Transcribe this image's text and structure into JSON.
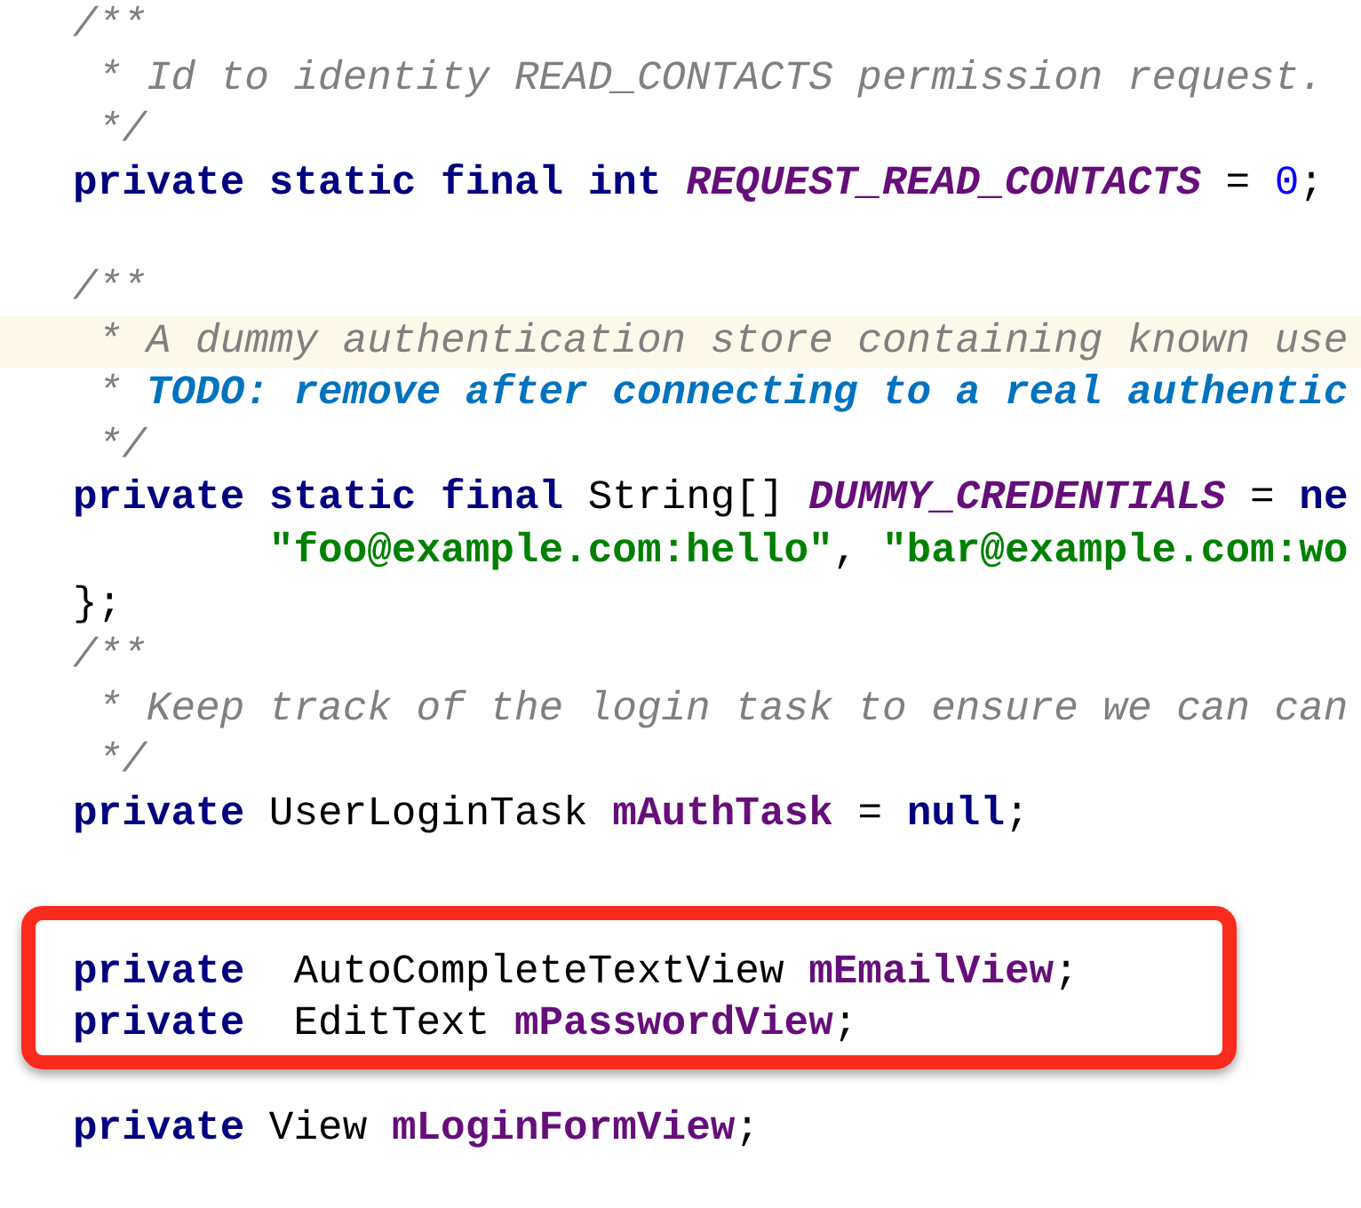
{
  "editor": {
    "lines": [
      {
        "kind": "code",
        "highlighted": false,
        "segments": [
          {
            "kind": "comment",
            "text": "/**"
          }
        ]
      },
      {
        "kind": "code",
        "highlighted": false,
        "segments": [
          {
            "kind": "comment",
            "text": " * Id to identity READ_CONTACTS permission request."
          }
        ]
      },
      {
        "kind": "code",
        "highlighted": false,
        "segments": [
          {
            "kind": "comment",
            "text": " */"
          }
        ]
      },
      {
        "kind": "code",
        "highlighted": false,
        "segments": [
          {
            "kind": "keyword",
            "text": "private static final int "
          },
          {
            "kind": "constant",
            "text": "REQUEST_READ_CONTACTS"
          },
          {
            "kind": "plain",
            "text": " = "
          },
          {
            "kind": "number",
            "text": "0"
          },
          {
            "kind": "plain",
            "text": ";"
          }
        ]
      },
      {
        "kind": "blank"
      },
      {
        "kind": "code",
        "highlighted": false,
        "segments": [
          {
            "kind": "comment",
            "text": "/**"
          }
        ]
      },
      {
        "kind": "code",
        "highlighted": true,
        "segments": [
          {
            "kind": "comment",
            "text": " * A dummy authentication store containing known use"
          }
        ]
      },
      {
        "kind": "code",
        "highlighted": false,
        "segments": [
          {
            "kind": "comment",
            "text": " * "
          },
          {
            "kind": "todo",
            "text": "TODO: remove after connecting to a real authentic"
          }
        ]
      },
      {
        "kind": "code",
        "highlighted": false,
        "segments": [
          {
            "kind": "comment",
            "text": " */"
          }
        ]
      },
      {
        "kind": "code",
        "highlighted": false,
        "segments": [
          {
            "kind": "keyword",
            "text": "private static final "
          },
          {
            "kind": "plain",
            "text": "String[] "
          },
          {
            "kind": "constant",
            "text": "DUMMY_CREDENTIALS"
          },
          {
            "kind": "plain",
            "text": " = "
          },
          {
            "kind": "keyword",
            "text": "ne"
          }
        ]
      },
      {
        "kind": "continuation",
        "highlighted": false,
        "segments": [
          {
            "kind": "string",
            "text": "\"foo@example.com:hello\""
          },
          {
            "kind": "plain",
            "text": ", "
          },
          {
            "kind": "string",
            "text": "\"bar@example.com:wo"
          }
        ]
      },
      {
        "kind": "code",
        "highlighted": false,
        "segments": [
          {
            "kind": "plain",
            "text": "};"
          }
        ]
      },
      {
        "kind": "code",
        "highlighted": false,
        "segments": [
          {
            "kind": "comment",
            "text": "/**"
          }
        ]
      },
      {
        "kind": "code",
        "highlighted": false,
        "segments": [
          {
            "kind": "comment",
            "text": " * Keep track of the login task to ensure we can can"
          }
        ]
      },
      {
        "kind": "code",
        "highlighted": false,
        "segments": [
          {
            "kind": "comment",
            "text": " */"
          }
        ]
      },
      {
        "kind": "code",
        "highlighted": false,
        "segments": [
          {
            "kind": "keyword",
            "text": "private "
          },
          {
            "kind": "plain",
            "text": "UserLoginTask "
          },
          {
            "kind": "field",
            "text": "mAuthTask"
          },
          {
            "kind": "plain",
            "text": " = "
          },
          {
            "kind": "keyword",
            "text": "null"
          },
          {
            "kind": "plain",
            "text": ";"
          }
        ]
      },
      {
        "kind": "blank"
      },
      {
        "kind": "blank"
      },
      {
        "kind": "code",
        "highlighted": false,
        "segments": [
          {
            "kind": "keyword",
            "text": "private "
          },
          {
            "kind": "plain",
            "text": " AutoCompleteTextView "
          },
          {
            "kind": "field",
            "text": "mEmailView"
          },
          {
            "kind": "plain",
            "text": ";"
          }
        ]
      },
      {
        "kind": "code",
        "highlighted": false,
        "segments": [
          {
            "kind": "keyword",
            "text": "private "
          },
          {
            "kind": "plain",
            "text": " EditText "
          },
          {
            "kind": "field",
            "text": "mPasswordView"
          },
          {
            "kind": "plain",
            "text": ";"
          }
        ]
      },
      {
        "kind": "blank"
      },
      {
        "kind": "code",
        "highlighted": false,
        "segments": [
          {
            "kind": "keyword",
            "text": "private "
          },
          {
            "kind": "plain",
            "text": "View "
          },
          {
            "kind": "field",
            "text": "mLoginFormView"
          },
          {
            "kind": "plain",
            "text": ";"
          }
        ]
      }
    ],
    "callout": {
      "kind": "frame"
    }
  }
}
